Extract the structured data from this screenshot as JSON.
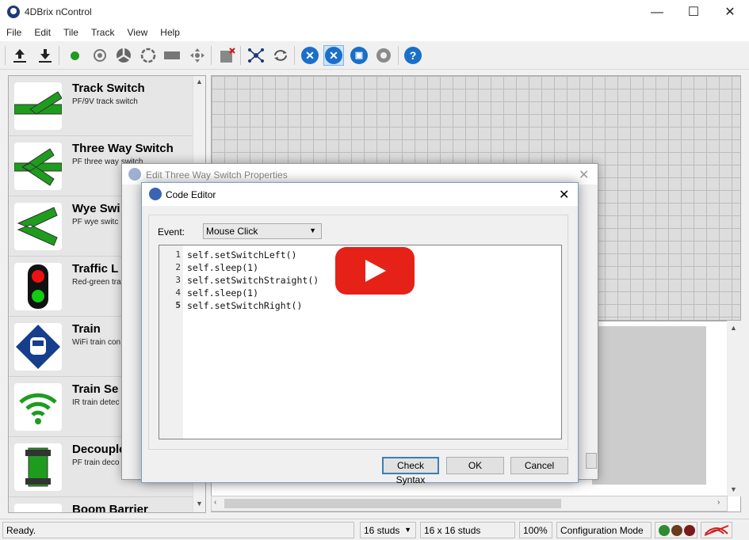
{
  "window": {
    "title": "4DBrix nControl",
    "controls": [
      "—",
      "☐",
      "✕"
    ]
  },
  "menu": [
    "File",
    "Edit",
    "Tile",
    "Track",
    "View",
    "Help"
  ],
  "toolbar": {
    "icons": [
      "upload-icon",
      "download-icon",
      "green-dot-icon",
      "target-icon",
      "turntable-icon",
      "circle-track-icon",
      "block-icon",
      "move-icon",
      "delete-tile-icon",
      "network-icon",
      "loop-icon",
      "tools-blue-icon",
      "tools-active-icon",
      "camera-icon",
      "gear-icon",
      "help-icon"
    ],
    "help_symbol": "?"
  },
  "palette": [
    {
      "title": "Track Switch",
      "desc": "PF/9V track switch"
    },
    {
      "title": "Three Way Switch",
      "desc": "PF three way switch"
    },
    {
      "title": "Wye Swi",
      "desc": "PF wye switc"
    },
    {
      "title": "Traffic L",
      "desc": "Red-green tra"
    },
    {
      "title": "Train",
      "desc": "WiFi train con"
    },
    {
      "title": "Train Se",
      "desc": "IR train detec"
    },
    {
      "title": "Decouple",
      "desc": "PF train deco"
    },
    {
      "title": "Boom Barrier",
      "desc": ""
    }
  ],
  "prop_dialog": {
    "title": "Edit Three Way Switch Properties",
    "close": "✕"
  },
  "code_editor": {
    "title": "Code Editor",
    "close": "✕",
    "event_label": "Event:",
    "event_value": "Mouse Click",
    "line_numbers": [
      "1",
      "2",
      "3",
      "4",
      "5"
    ],
    "lines": [
      "self.setSwitchLeft()",
      "self.sleep(1)",
      "self.setSwitchStraight()",
      "self.sleep(1)",
      "self.setSwitchRight()"
    ],
    "buttons": {
      "check": "Check Syntax",
      "ok": "OK",
      "cancel": "Cancel"
    }
  },
  "status": {
    "text": "Ready.",
    "studs": "16 studs",
    "grid_size": "16 x 16 studs",
    "zoom": "100%",
    "mode": "Configuration Mode",
    "leds": [
      "#2e8b2e",
      "#6b3b1f",
      "#7a1a1a"
    ],
    "colors": {
      "accent": "#1a6fc9",
      "track_green": "#1e9c1e"
    }
  }
}
